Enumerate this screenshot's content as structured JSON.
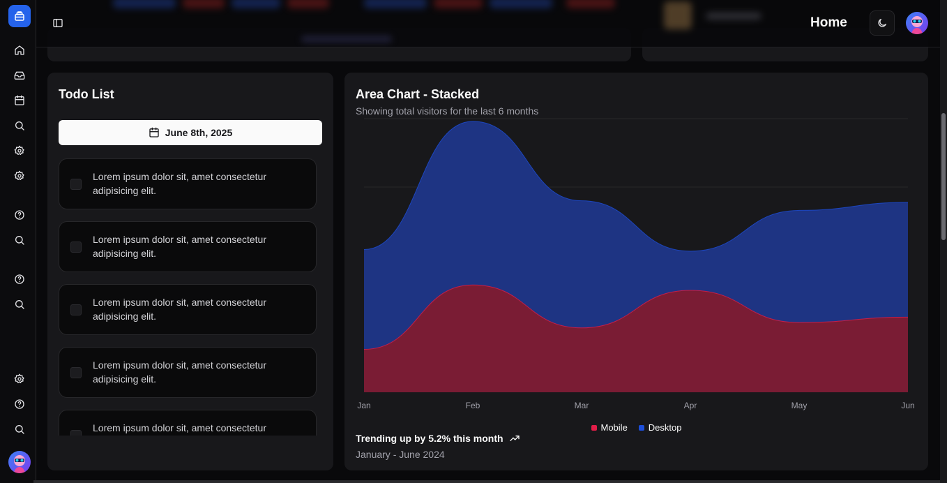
{
  "header": {
    "title": "Home"
  },
  "todo": {
    "title": "Todo List",
    "date": "June 8th, 2025",
    "items": [
      "Lorem ipsum dolor sit, amet consectetur adipisicing elit.",
      "Lorem ipsum dolor sit, amet consectetur adipisicing elit.",
      "Lorem ipsum dolor sit, amet consectetur adipisicing elit.",
      "Lorem ipsum dolor sit, amet consectetur adipisicing elit.",
      "Lorem ipsum dolor sit, amet consectetur adipisicing elit."
    ]
  },
  "chart_card": {
    "title": "Area Chart - Stacked",
    "subtitle": "Showing total visitors for the last 6 months",
    "trend": "Trending up by 5.2% this month",
    "range": "January - June 2024"
  },
  "chart_data": {
    "type": "area",
    "stacked": true,
    "categories": [
      "Jan",
      "Feb",
      "Mar",
      "Apr",
      "May",
      "Jun"
    ],
    "series": [
      {
        "name": "Mobile",
        "color": "#e11d48",
        "values": [
          80,
          200,
          120,
          190,
          130,
          140
        ]
      },
      {
        "name": "Desktop",
        "color": "#1d4ed8",
        "values": [
          186,
          305,
          237,
          73,
          209,
          214
        ]
      }
    ],
    "ylim": [
      0,
      510
    ],
    "grid": true,
    "legend": "bottom"
  },
  "icons": {
    "sidebar_top": [
      "home-icon",
      "inbox-icon",
      "calendar-icon",
      "search-icon",
      "settings-icon",
      "settings-icon"
    ],
    "sidebar_mid": [
      "help-icon",
      "search-icon",
      "help-icon",
      "search-icon"
    ],
    "sidebar_bottom": [
      "settings-icon",
      "help-icon",
      "search-icon"
    ]
  }
}
